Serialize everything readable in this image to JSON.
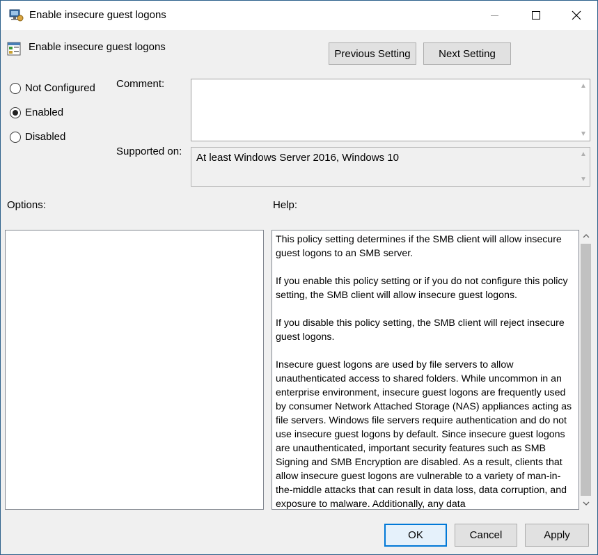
{
  "window": {
    "title": "Enable insecure guest logons",
    "setting_title": "Enable insecure guest logons"
  },
  "nav": {
    "previous_label": "Previous Setting",
    "next_label": "Next Setting"
  },
  "state": {
    "options": [
      {
        "label": "Not Configured",
        "selected": false
      },
      {
        "label": "Enabled",
        "selected": true
      },
      {
        "label": "Disabled",
        "selected": false
      }
    ]
  },
  "comment": {
    "label": "Comment:",
    "value": ""
  },
  "supported": {
    "label": "Supported on:",
    "value": "At least Windows Server 2016, Windows 10"
  },
  "panels": {
    "options_label": "Options:",
    "help_label": "Help:"
  },
  "help": {
    "paragraphs": [
      "This policy setting determines if the SMB client will allow insecure guest logons to an SMB server.",
      "If you enable this policy setting or if you do not configure this policy setting, the SMB client will allow insecure guest logons.",
      "If you disable this policy setting, the SMB client will reject insecure guest logons.",
      "Insecure guest logons are used by file servers to allow unauthenticated access to shared folders. While uncommon in an enterprise environment, insecure guest logons are frequently used by consumer Network Attached Storage (NAS) appliances acting as file servers. Windows file servers require authentication and do not use insecure guest logons by default. Since insecure guest logons are unauthenticated, important security features such as SMB Signing and SMB Encryption are disabled. As a result, clients that allow insecure guest logons are vulnerable to a variety of man-in-the-middle attacks that can result in data loss, data corruption, and exposure to malware. Additionally, any data"
    ]
  },
  "buttons": {
    "ok": "OK",
    "cancel": "Cancel",
    "apply": "Apply"
  }
}
